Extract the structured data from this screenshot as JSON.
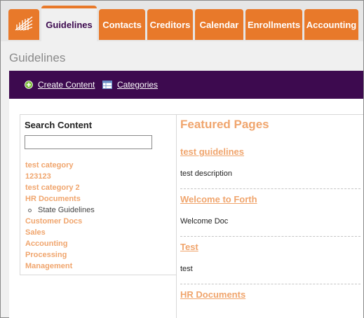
{
  "nav": {
    "tabs": [
      {
        "label": "Guidelines",
        "active": true
      },
      {
        "label": "Contacts"
      },
      {
        "label": "Creditors"
      },
      {
        "label": "Calendar"
      },
      {
        "label": "Enrollments"
      },
      {
        "label": "Accounting"
      }
    ],
    "accent_color": "#e8792a",
    "logo_icon": "logo-icon"
  },
  "page": {
    "title": "Guidelines"
  },
  "toolbar": {
    "create_content_label": "Create Content",
    "categories_label": "Categories",
    "background": "#3d0a4f"
  },
  "search": {
    "title": "Search Content",
    "value": "",
    "categories": [
      "test category",
      "123123",
      "test category 2",
      "HR Documents"
    ],
    "subcategory": "State Guidelines",
    "categories_more": [
      "Customer Docs",
      "Sales",
      "Accounting",
      "Processing",
      "Management"
    ]
  },
  "featured": {
    "title": "Featured Pages",
    "pages": [
      {
        "title": "test guidelines",
        "description": "test description"
      },
      {
        "title": "Welcome to Forth",
        "description": "Welcome Doc"
      },
      {
        "title": "Test",
        "description": "test"
      },
      {
        "title": "HR Documents",
        "description": ""
      }
    ],
    "link_color": "#f0a56d"
  }
}
